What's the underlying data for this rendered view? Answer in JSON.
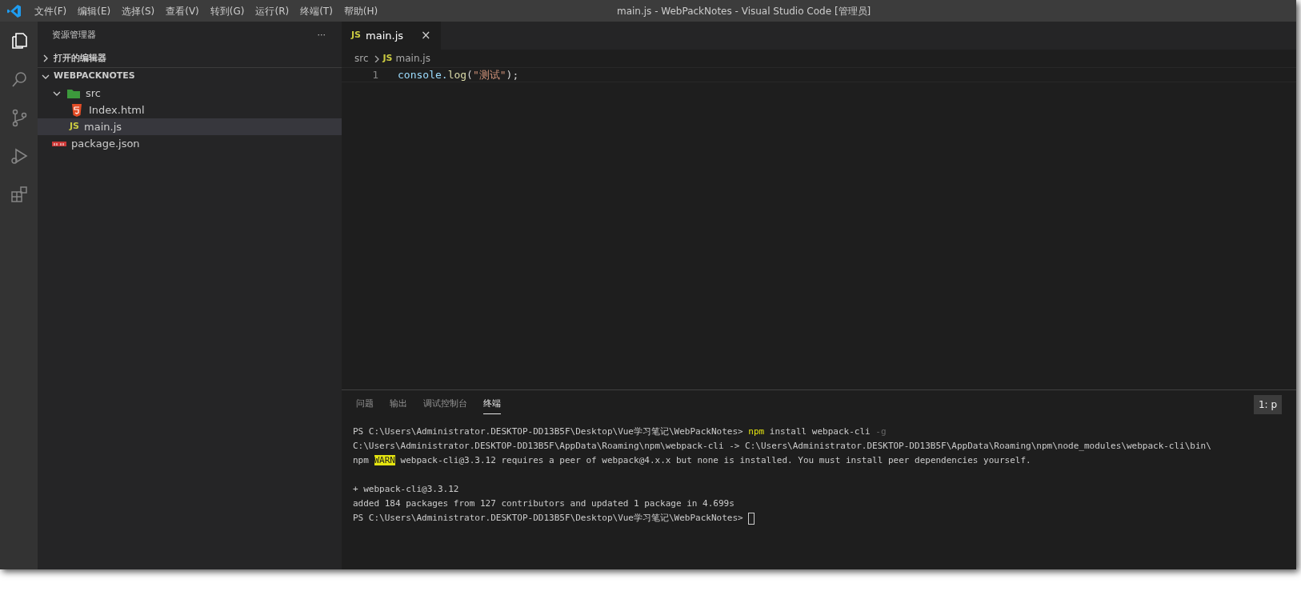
{
  "window": {
    "title": "main.js - WebPackNotes - Visual Studio Code [管理员]"
  },
  "menu": [
    "文件(F)",
    "编辑(E)",
    "选择(S)",
    "查看(V)",
    "转到(G)",
    "运行(R)",
    "终端(T)",
    "帮助(H)"
  ],
  "activity_bar": [
    {
      "kind": "files",
      "selected": true
    },
    {
      "kind": "search",
      "selected": false
    },
    {
      "kind": "scm",
      "selected": false
    },
    {
      "kind": "debug",
      "selected": false
    },
    {
      "kind": "extensions",
      "selected": false
    }
  ],
  "sidebar": {
    "title": "资源管理器",
    "more": "···",
    "sections": [
      {
        "label": "打开的编辑器",
        "expanded": false
      },
      {
        "label": "WEBPACKNOTES",
        "expanded": true
      }
    ],
    "tree": [
      {
        "label": "src",
        "kind": "folder",
        "expanded": true,
        "selected": false,
        "children": [
          {
            "label": "Index.html",
            "kind": "html",
            "selected": false
          },
          {
            "label": "main.js",
            "kind": "js",
            "badge": "JS",
            "selected": true
          }
        ]
      },
      {
        "label": "package.json",
        "kind": "npm",
        "selected": false
      }
    ]
  },
  "editor": {
    "tabs": [
      {
        "label": "main.js",
        "badge": "JS",
        "close": "×",
        "selected": true
      }
    ],
    "breadcrumb": [
      {
        "label": "src"
      },
      {
        "label": "main.js",
        "badge": "JS"
      }
    ],
    "lines": [
      {
        "number": "1",
        "segments": [
          {
            "text": "console.",
            "kind": "ident"
          },
          {
            "text": "log",
            "kind": "func"
          },
          {
            "text": "(",
            "kind": "plain"
          },
          {
            "text": "\"测试\"",
            "kind": "string"
          },
          {
            "text": ");",
            "kind": "plain"
          }
        ]
      }
    ]
  },
  "panel": {
    "tabs": [
      {
        "label": "问题",
        "selected": false
      },
      {
        "label": "输出",
        "selected": false
      },
      {
        "label": "调试控制台",
        "selected": false
      },
      {
        "label": "终端",
        "selected": true
      }
    ],
    "terminal_select": "1: p",
    "lines": [
      {
        "blank_before": false,
        "cursor": false,
        "segments": [
          {
            "text": "PS C:\\Users\\Administrator.DESKTOP-DD13B5F\\Desktop\\Vue学习笔记\\WebPackNotes> ",
            "kind": "plain"
          },
          {
            "text": "npm",
            "kind": "command"
          },
          {
            "text": " install webpack-cli ",
            "kind": "plain"
          },
          {
            "text": "-g",
            "kind": "flag"
          }
        ]
      },
      {
        "blank_before": false,
        "cursor": false,
        "segments": [
          {
            "text": "C:\\Users\\Administrator.DESKTOP-DD13B5F\\AppData\\Roaming\\npm\\webpack-cli -> C:\\Users\\Administrator.DESKTOP-DD13B5F\\AppData\\Roaming\\npm\\node_modules\\webpack-cli\\bin\\",
            "kind": "plain"
          }
        ]
      },
      {
        "blank_before": false,
        "cursor": false,
        "segments": [
          {
            "text": "npm ",
            "kind": "plain"
          },
          {
            "text": "WARN",
            "kind": "warn"
          },
          {
            "text": " webpack-cli@3.3.12 requires a peer of webpack@4.x.x but none is installed. You must install peer dependencies yourself.",
            "kind": "plain"
          }
        ]
      },
      {
        "blank_before": true,
        "cursor": false,
        "segments": [
          {
            "text": "+ webpack-cli@3.3.12",
            "kind": "plain"
          }
        ]
      },
      {
        "blank_before": false,
        "cursor": false,
        "segments": [
          {
            "text": "added 184 packages from 127 contributors and updated 1 package in 4.699s",
            "kind": "plain"
          }
        ]
      },
      {
        "blank_before": false,
        "cursor": true,
        "segments": [
          {
            "text": "PS C:\\Users\\Administrator.DESKTOP-DD13B5F\\Desktop\\Vue学习笔记\\WebPackNotes> ",
            "kind": "plain"
          }
        ]
      }
    ]
  }
}
